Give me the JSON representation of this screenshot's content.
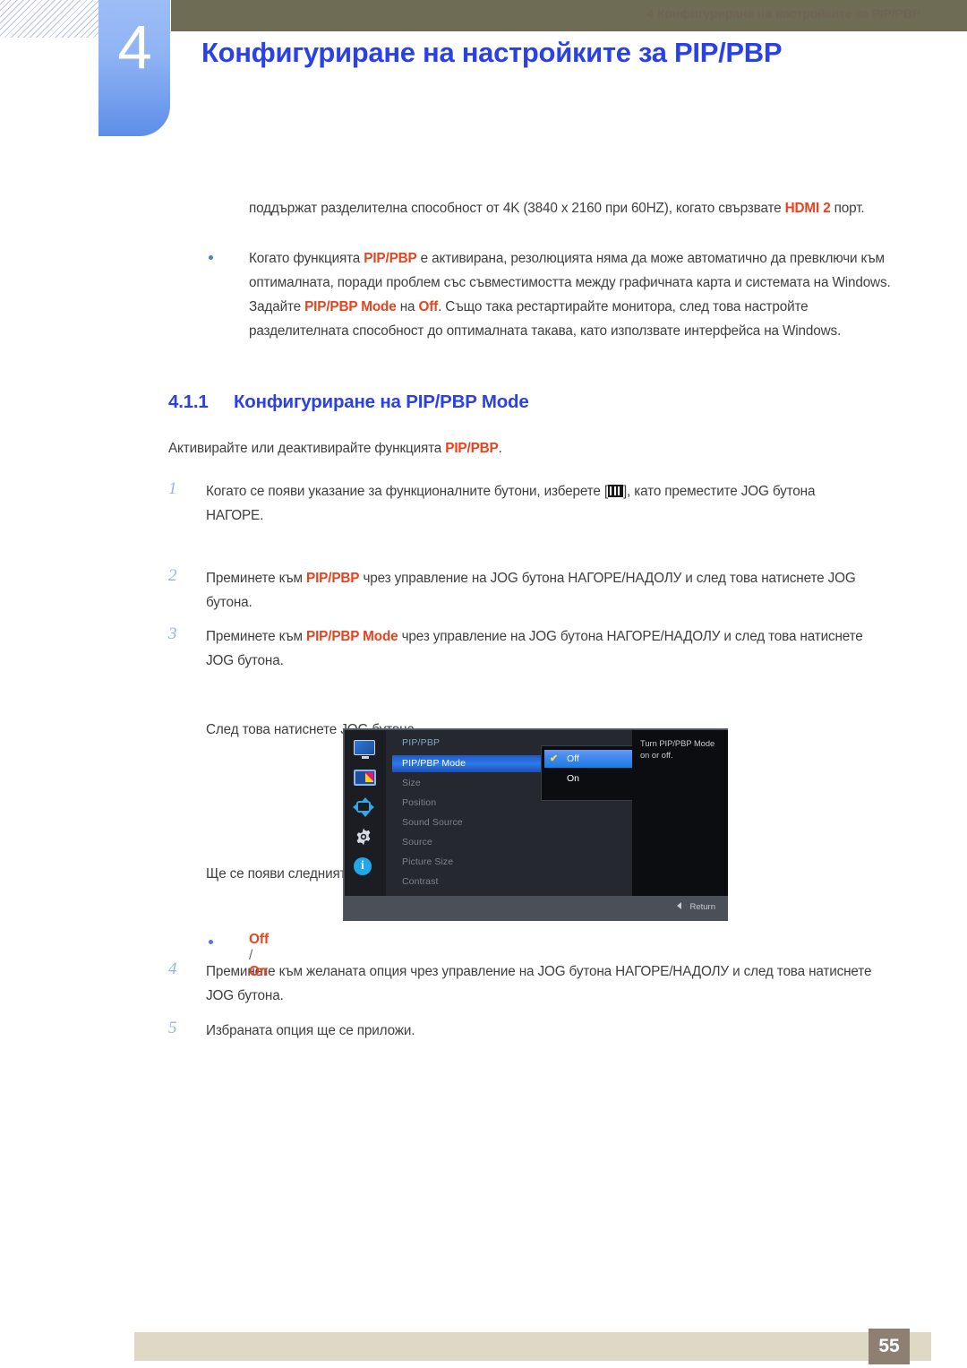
{
  "header": {
    "chapter_number": "4",
    "title": "Конфигуриране на настройките за PIP/PBP"
  },
  "content": {
    "continuation_paragraph_parts": {
      "t1": "поддържат разделителна способност от 4K (3840 x 2160 при 60HZ), когато свързвате ",
      "hl1": "HDMI 2",
      "t2": " порт."
    },
    "bullet_paragraph_parts": {
      "t1": "Когато функцията ",
      "hl1": "PIP/PBP",
      "t2": " е активирана, резолюцията няма да може автоматично да превключи към оптималната, поради проблем със съвместимостта между графичната карта и системата на Windows. Задайте ",
      "hl2": "PIP/PBP Mode",
      "t3": " на ",
      "hl3": "Off",
      "t4": ". Също така рестартирайте монитора, след това настройте разделителната способност до оптималната такава, като използвате интерфейса на Windows."
    },
    "section": {
      "number": "4.1.1",
      "title": "Конфигуриране на PIP/PBP Mode"
    },
    "intro_parts": {
      "t1": "Активирайте или деактивирайте функцията ",
      "hl1": "PIP/PBP",
      "t2": "."
    },
    "steps": [
      {
        "number": "1",
        "t1": "Когато се появи указание за функционалните бутони, изберете [",
        "icon": "menu-bars-icon",
        "t2": "], като преместите JOG бутона НАГОРЕ.",
        "sub": "След това натиснете JOG бутона."
      },
      {
        "number": "2",
        "t1": "Преминете към ",
        "hl1": "PIP/PBP",
        "t2": " чрез управление на JOG бутона НАГОРЕ/НАДОЛУ и след това натиснете JOG бутона."
      },
      {
        "number": "3",
        "t1": "Преминете към ",
        "hl1": "PIP/PBP Mode",
        "t2": " чрез управление на JOG бутона НАГОРЕ/НАДОЛУ и след това натиснете JOG бутона.",
        "sub": "Ще се появи следният екран."
      },
      {
        "number": "4",
        "t1": "Преминете към желаната опция чрез управление на JOG бутона НАГОРЕ/НАДОЛУ и след това натиснете JOG бутона."
      },
      {
        "number": "5",
        "t1": "Избраната опция ще се приложи."
      }
    ],
    "option_bullet": {
      "off": "Off",
      "separator": " / ",
      "on": "On"
    }
  },
  "osd": {
    "menu_title": "PIP/PBP",
    "rail_icons": [
      "display-icon",
      "pip-pbp-icon",
      "position-arrows-icon",
      "gear-icon",
      "info-icon"
    ],
    "rows": [
      {
        "label": "PIP/PBP Mode",
        "active": true
      },
      {
        "label": "Size",
        "active": false
      },
      {
        "label": "Position",
        "active": false
      },
      {
        "label": "Sound Source",
        "active": false
      },
      {
        "label": "Source",
        "active": false
      },
      {
        "label": "Picture Size",
        "active": false
      },
      {
        "label": "Contrast",
        "active": false
      }
    ],
    "dropdown": {
      "options": [
        {
          "label": "Off",
          "selected": true,
          "check": "✔"
        },
        {
          "label": "On",
          "selected": false,
          "check": ""
        }
      ]
    },
    "help_text": "Turn PIP/PBP Mode on or off.",
    "return_label": "Return"
  },
  "footer": {
    "text": "4 Конфигуриране на настройките за PIP/PBP",
    "page": "55"
  },
  "colors": {
    "accent_blue": "#2a41e8",
    "highlight_orange": "#e8431f",
    "header_olive": "#6f6c55",
    "footer_beige": "#ded8c4",
    "page_box": "#8d7f72"
  }
}
